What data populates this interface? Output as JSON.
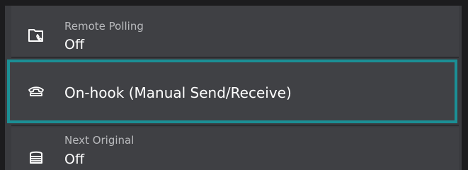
{
  "items": [
    {
      "icon": "phone-document-icon",
      "label": "Remote Polling",
      "value": "Off"
    },
    {
      "icon": "on-hook-phone-icon",
      "label": "On-hook (Manual Send/Receive)"
    },
    {
      "icon": "document-stack-icon",
      "label": "Next Original",
      "value": "Off"
    }
  ],
  "colors": {
    "background": "#3a3b3f",
    "selection_border": "#1b8f95",
    "text": "#ffffff",
    "subtext": "#b9babd"
  }
}
